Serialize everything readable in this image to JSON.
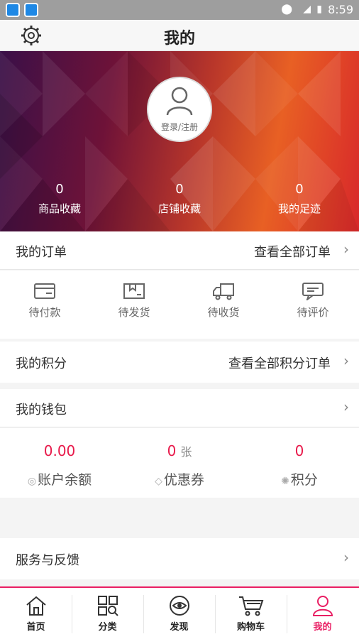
{
  "status_bar": {
    "time": "8:59"
  },
  "header": {
    "title": "我的"
  },
  "profile": {
    "login_label": "登录/注册",
    "stats": [
      {
        "value": "0",
        "label": "商品收藏"
      },
      {
        "value": "0",
        "label": "店铺收藏"
      },
      {
        "value": "0",
        "label": "我的足迹"
      }
    ]
  },
  "orders": {
    "title": "我的订单",
    "view_all": "查看全部订单",
    "tabs": [
      {
        "label": "待付款",
        "icon": "wallet-icon"
      },
      {
        "label": "待发货",
        "icon": "box-icon"
      },
      {
        "label": "待收货",
        "icon": "truck-icon"
      },
      {
        "label": "待评价",
        "icon": "comment-icon"
      }
    ]
  },
  "points": {
    "title": "我的积分",
    "view_all": "查看全部积分订单"
  },
  "wallet": {
    "title": "我的钱包",
    "balance": {
      "value": "0.00",
      "label": "账户余额"
    },
    "coupons": {
      "value": "0",
      "unit": "张",
      "label": "优惠券"
    },
    "points": {
      "value": "0",
      "label": "积分"
    }
  },
  "service": {
    "title": "服务与反馈"
  },
  "tabbar": {
    "items": [
      {
        "label": "首页",
        "icon": "home-icon"
      },
      {
        "label": "分类",
        "icon": "category-icon"
      },
      {
        "label": "发现",
        "icon": "discover-icon"
      },
      {
        "label": "购物车",
        "icon": "cart-icon"
      },
      {
        "label": "我的",
        "icon": "user-icon",
        "active": true
      }
    ]
  },
  "colors": {
    "accent": "#e91e63",
    "value_red": "#e8194a"
  }
}
